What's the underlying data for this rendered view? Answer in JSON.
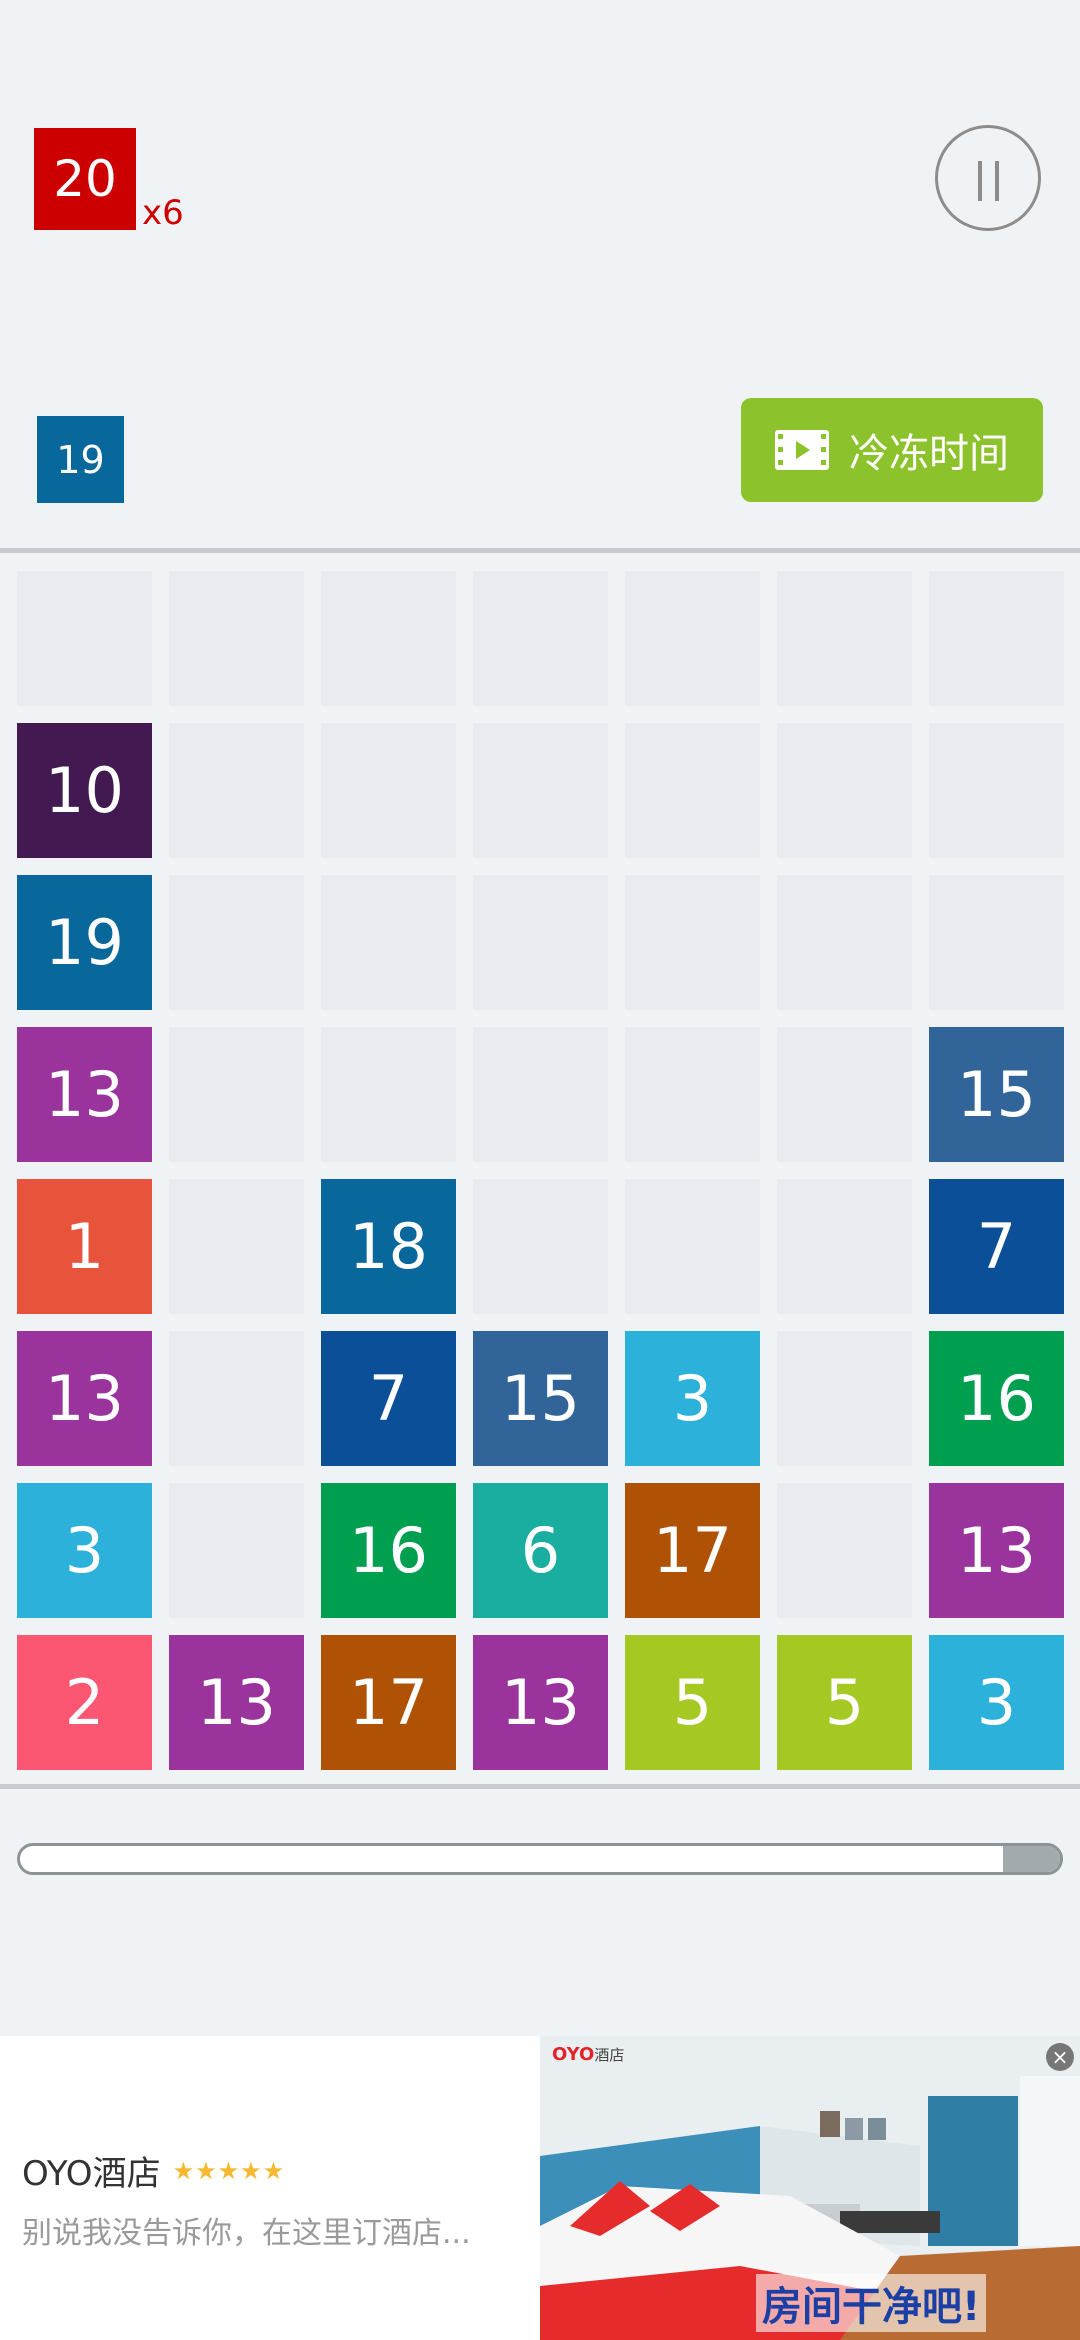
{
  "target": {
    "value": "20",
    "color": "#cc0000",
    "multiplier": "x6"
  },
  "next_tile": {
    "value": "19",
    "color": "#08679b"
  },
  "freeze_button": {
    "label": "冷冻时间",
    "icon": "film-icon",
    "color": "#8cc22b"
  },
  "pause_icon": "pause-icon",
  "board": {
    "columns": 7,
    "rows": [
      [
        null,
        null,
        null,
        null,
        null,
        null,
        null
      ],
      [
        "10",
        null,
        null,
        null,
        null,
        null,
        null
      ],
      [
        "19",
        null,
        null,
        null,
        null,
        null,
        null
      ],
      [
        "13",
        null,
        null,
        null,
        null,
        null,
        "15"
      ],
      [
        "1",
        null,
        "18",
        null,
        null,
        null,
        "7"
      ],
      [
        "13",
        null,
        "7",
        "15",
        "3",
        null,
        "16"
      ],
      [
        "3",
        null,
        "16",
        "6",
        "17",
        null,
        "13"
      ],
      [
        "2",
        "13",
        "17",
        "13",
        "5",
        "5",
        "3"
      ]
    ],
    "colors": {
      "1": "#e8543b",
      "2": "#fb5672",
      "3": "#2cb1db",
      "5": "#a5c822",
      "6": "#1aaea1",
      "7": "#0b4f99",
      "10": "#421a51",
      "13": "#9a339b",
      "15": "#316599",
      "16": "#009f4f",
      "17": "#af5205",
      "18": "#08679b",
      "19": "#08679b"
    },
    "empty_color": "#e8ebef"
  },
  "progress": {
    "remaining_fraction": 0.055
  },
  "ad": {
    "title": "OYO酒店",
    "stars": "★★★★★",
    "description": "别说我没告诉你，在这里订酒店...",
    "image_logo": "OYO",
    "image_logo_sub": "酒店",
    "image_slogan": "房间干净吧!",
    "close_icon": "close-icon"
  }
}
